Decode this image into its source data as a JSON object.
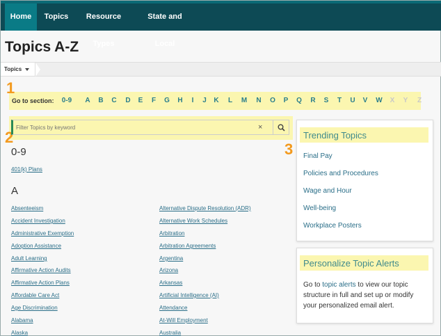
{
  "nav": {
    "items": [
      "Home",
      "Topics",
      "Resource Types",
      "State and Local"
    ]
  },
  "page": {
    "title": "Topics A-Z"
  },
  "breadcrumb": {
    "label": "Topics"
  },
  "annotations": [
    "1",
    "2",
    "3"
  ],
  "section_nav": {
    "label": "Go to section:",
    "letters": [
      "0-9",
      "A",
      "B",
      "C",
      "D",
      "E",
      "F",
      "G",
      "H",
      "I",
      "J",
      "K",
      "L",
      "M",
      "N",
      "O",
      "P",
      "Q",
      "R",
      "S",
      "T",
      "U",
      "V",
      "W",
      "X",
      "Y",
      "Z"
    ],
    "disabled": [
      "X",
      "Y",
      "Z"
    ]
  },
  "filter": {
    "placeholder": "Filter Topics by keyword",
    "clear": "×"
  },
  "sections": {
    "s09": {
      "heading": "0-9",
      "items": [
        "401(k) Plans"
      ]
    },
    "sA": {
      "heading": "A",
      "left": [
        "Absenteeism",
        "Accident Investigation",
        "Administrative Exemption",
        "Adoption Assistance",
        "Adult Learning",
        "Affirmative Action Audits",
        "Affirmative Action Plans",
        "Affordable Care Act",
        "Age Discrimination",
        "Alabama",
        "Alaska"
      ],
      "right": [
        "Alternative Dispute Resolution (ADR)",
        "Alternative Work Schedules",
        "Arbitration",
        "Arbitration Agreements",
        "Argentina",
        "Arizona",
        "Arkansas",
        "Artificial Intelligence (AI)",
        "Attendance",
        "At-Will Employment",
        "Australia"
      ]
    }
  },
  "trending": {
    "heading": "Trending Topics",
    "items": [
      "Final Pay",
      "Policies and Procedures",
      "Wage and Hour",
      "Well-being",
      "Workplace Posters"
    ]
  },
  "alerts": {
    "heading": "Personalize Topic Alerts",
    "text_before": "Go to ",
    "link": "topic alerts",
    "text_after": " to view our topic structure in full and set up or modify your personalized email alert."
  },
  "colors": {
    "nav_bg": "#0d4a55",
    "nav_active": "#0a7b86",
    "link": "#2a6e88",
    "highlight": "#fbf6b0",
    "annotation": "#f39a1e"
  }
}
